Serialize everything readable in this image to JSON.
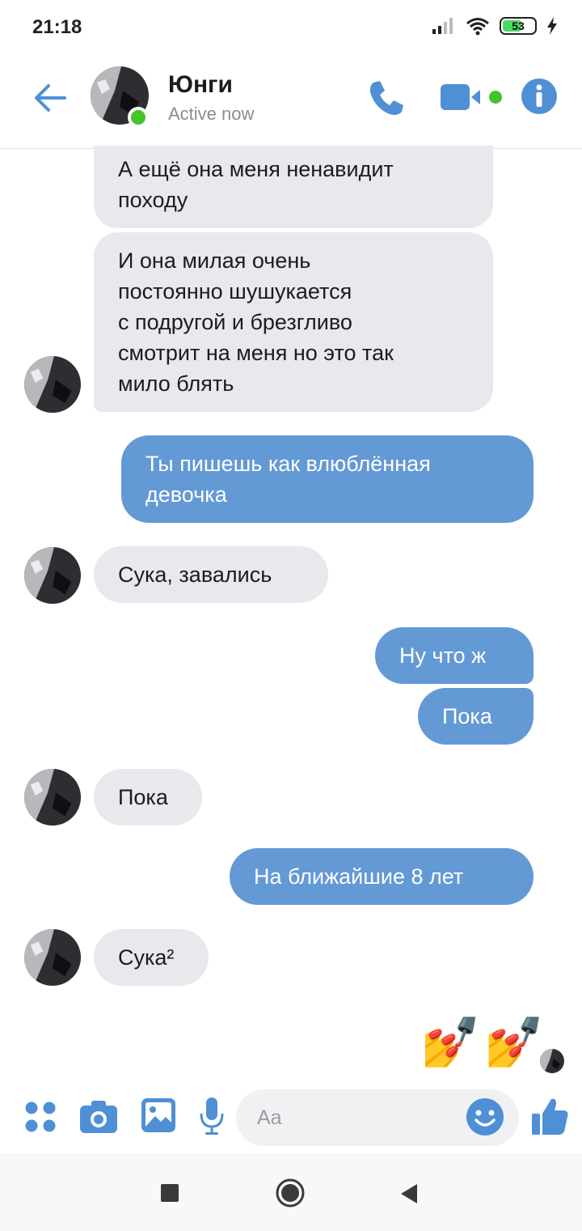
{
  "status_bar": {
    "time": "21:18",
    "battery": "53"
  },
  "header": {
    "name": "Юнги",
    "status": "Active now"
  },
  "messages": [
    {
      "dir": "in",
      "text": "А ещё она меня ненавидит\nпоходу"
    },
    {
      "dir": "in",
      "text": "И она милая очень\nпостоянно шушукается\nс подругой и брезгливо\nсмотрит на меня но это так\nмило блять"
    },
    {
      "dir": "out",
      "text": "Ты пишешь как влюблённая\nдевочка"
    },
    {
      "dir": "in",
      "text": "Сука, завались"
    },
    {
      "dir": "out",
      "text": "Ну что ж"
    },
    {
      "dir": "out",
      "text": "Пока"
    },
    {
      "dir": "in",
      "text": "Пока"
    },
    {
      "dir": "out",
      "text": "На ближайшие 8 лет"
    },
    {
      "dir": "in",
      "text": "Сука²"
    }
  ],
  "last_reaction": {
    "emoji": "💅💅"
  },
  "composer": {
    "placeholder": "Aa"
  },
  "colors": {
    "accent": "#4f8fd6",
    "outgoing_bubble": "#6399d5",
    "incoming_bubble": "#e9e8ed",
    "online": "#42c42a"
  }
}
